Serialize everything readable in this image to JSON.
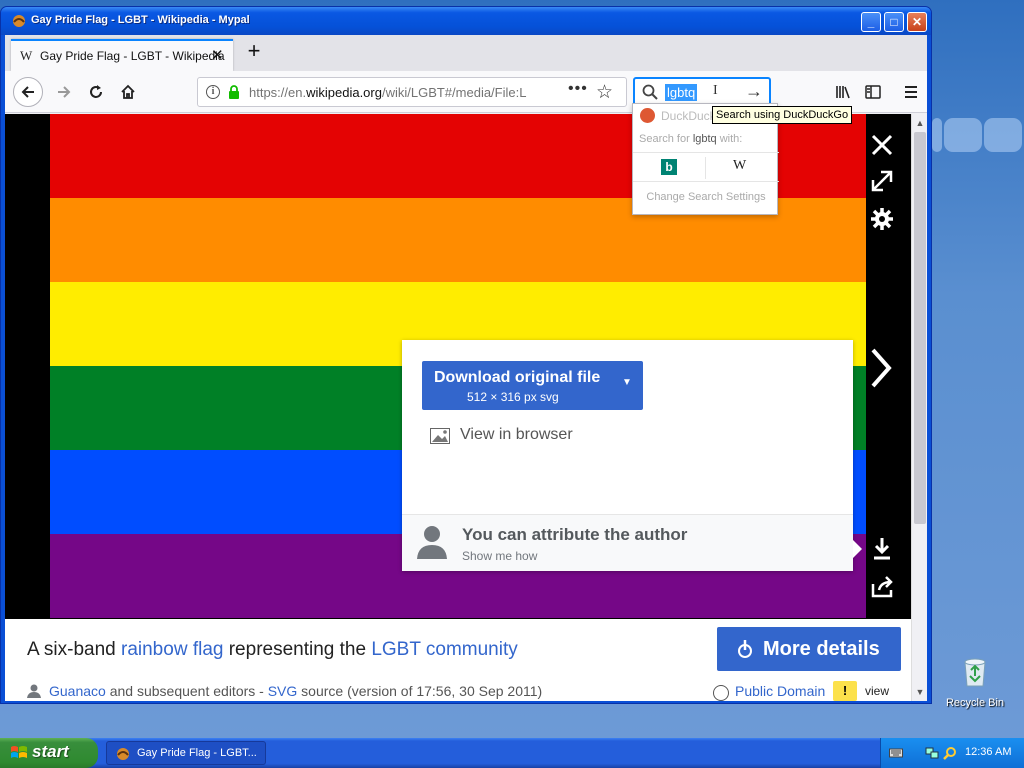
{
  "window": {
    "title": "Gay Pride Flag - LGBT - Wikipedia - Mypal",
    "buttons": {
      "minimize": "_",
      "maximize": "□",
      "close": "✕"
    }
  },
  "tab": {
    "favicon": "W",
    "title": "Gay Pride Flag - LGBT - Wikipedia",
    "close": "✕",
    "new_tab": "+"
  },
  "navbar": {
    "url_prefix": "https://en.",
    "url_domain": "wikipedia.org",
    "url_rest": "/wiki/LGBT#/media/File:L",
    "search_query": "lgbtq",
    "icons": [
      "back-icon",
      "forward-icon",
      "reload-icon",
      "home-icon",
      "library-icon",
      "sidebar-icon",
      "menu-icon"
    ]
  },
  "search_popup": {
    "engine_label": "DuckDuck",
    "search_for_prefix": "Search for ",
    "search_for_query": "lgbtq",
    "search_for_suffix": " with:",
    "bing_glyph": "b",
    "wiki_glyph": "W",
    "settings": "Change Search Settings",
    "tooltip": "Search using DuckDuckGo"
  },
  "flag": {
    "colors": [
      "#e40303",
      "#ff8c00",
      "#ffed00",
      "#008026",
      "#004dff",
      "#750787"
    ]
  },
  "download_panel": {
    "download_label": "Download original file",
    "download_size": "512 × 316 px svg",
    "caret": "▼",
    "view_in_browser": "View in browser",
    "attrib_title": "You can attribute the author",
    "attrib_link": "Show me how"
  },
  "caption": {
    "prefix": "A six-band ",
    "link1": "rainbow flag",
    "middle": " representing the ",
    "link2": "LGBT community",
    "more_details": "More details"
  },
  "meta": {
    "author": "Guanaco",
    "editors": " and subsequent editors - ",
    "svg": "SVG",
    "source": " source (version of 17:56, 30 Sep 2011)",
    "license": "Public Domain",
    "warn": "!",
    "view": "view"
  },
  "desktop": {
    "recycle_bin": "Recycle Bin"
  },
  "taskbar": {
    "start": "start",
    "task_item": "Gay Pride Flag - LGBT...",
    "clock": "12:36 AM"
  },
  "colors": {
    "accent": "#3366cc",
    "titlebar": "#0551d8",
    "start": "#388e3c"
  }
}
